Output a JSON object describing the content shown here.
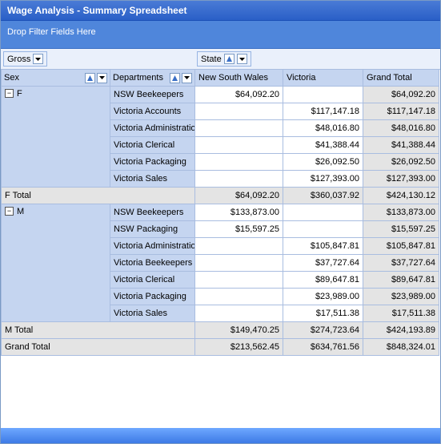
{
  "title": "Wage Analysis - Summary Spreadsheet",
  "filterHint": "Drop Filter Fields Here",
  "dataField": {
    "label": "Gross"
  },
  "colField": {
    "label": "State"
  },
  "rowFields": {
    "sex": "Sex",
    "dept": "Departments"
  },
  "columns": {
    "nsw": "New South Wales",
    "vic": "Victoria",
    "gt": "Grand Total"
  },
  "groups": [
    {
      "key": "F",
      "rows": [
        {
          "dept": "NSW Beekeepers",
          "nsw": "$64,092.20",
          "vic": "",
          "gt": "$64,092.20"
        },
        {
          "dept": "Victoria Accounts",
          "nsw": "",
          "vic": "$117,147.18",
          "gt": "$117,147.18"
        },
        {
          "dept": "Victoria Administration",
          "nsw": "",
          "vic": "$48,016.80",
          "gt": "$48,016.80"
        },
        {
          "dept": "Victoria Clerical",
          "nsw": "",
          "vic": "$41,388.44",
          "gt": "$41,388.44"
        },
        {
          "dept": "Victoria Packaging",
          "nsw": "",
          "vic": "$26,092.50",
          "gt": "$26,092.50"
        },
        {
          "dept": "Victoria Sales",
          "nsw": "",
          "vic": "$127,393.00",
          "gt": "$127,393.00"
        }
      ],
      "totalLabel": "F Total",
      "total": {
        "nsw": "$64,092.20",
        "vic": "$360,037.92",
        "gt": "$424,130.12"
      }
    },
    {
      "key": "M",
      "rows": [
        {
          "dept": "NSW Beekeepers",
          "nsw": "$133,873.00",
          "vic": "",
          "gt": "$133,873.00"
        },
        {
          "dept": "NSW Packaging",
          "nsw": "$15,597.25",
          "vic": "",
          "gt": "$15,597.25"
        },
        {
          "dept": "Victoria Administration",
          "nsw": "",
          "vic": "$105,847.81",
          "gt": "$105,847.81"
        },
        {
          "dept": "Victoria Beekeepers",
          "nsw": "",
          "vic": "$37,727.64",
          "gt": "$37,727.64"
        },
        {
          "dept": "Victoria Clerical",
          "nsw": "",
          "vic": "$89,647.81",
          "gt": "$89,647.81"
        },
        {
          "dept": "Victoria Packaging",
          "nsw": "",
          "vic": "$23,989.00",
          "gt": "$23,989.00"
        },
        {
          "dept": "Victoria Sales",
          "nsw": "",
          "vic": "$17,511.38",
          "gt": "$17,511.38"
        }
      ],
      "totalLabel": "M Total",
      "total": {
        "nsw": "$149,470.25",
        "vic": "$274,723.64",
        "gt": "$424,193.89"
      }
    }
  ],
  "grandTotalLabel": "Grand Total",
  "grandTotal": {
    "nsw": "$213,562.45",
    "vic": "$634,761.56",
    "gt": "$848,324.01"
  },
  "chart_data": {
    "type": "table",
    "title": "Wage Analysis - Summary Spreadsheet",
    "pivot": {
      "data_field": "Gross",
      "column_field": "State",
      "row_fields": [
        "Sex",
        "Departments"
      ],
      "columns": [
        "New South Wales",
        "Victoria",
        "Grand Total"
      ],
      "rows": [
        {
          "Sex": "F",
          "Department": "NSW Beekeepers",
          "New South Wales": 64092.2,
          "Victoria": null,
          "Grand Total": 64092.2
        },
        {
          "Sex": "F",
          "Department": "Victoria Accounts",
          "New South Wales": null,
          "Victoria": 117147.18,
          "Grand Total": 117147.18
        },
        {
          "Sex": "F",
          "Department": "Victoria Administration",
          "New South Wales": null,
          "Victoria": 48016.8,
          "Grand Total": 48016.8
        },
        {
          "Sex": "F",
          "Department": "Victoria Clerical",
          "New South Wales": null,
          "Victoria": 41388.44,
          "Grand Total": 41388.44
        },
        {
          "Sex": "F",
          "Department": "Victoria Packaging",
          "New South Wales": null,
          "Victoria": 26092.5,
          "Grand Total": 26092.5
        },
        {
          "Sex": "F",
          "Department": "Victoria Sales",
          "New South Wales": null,
          "Victoria": 127393.0,
          "Grand Total": 127393.0
        },
        {
          "Sex": "M",
          "Department": "NSW Beekeepers",
          "New South Wales": 133873.0,
          "Victoria": null,
          "Grand Total": 133873.0
        },
        {
          "Sex": "M",
          "Department": "NSW Packaging",
          "New South Wales": 15597.25,
          "Victoria": null,
          "Grand Total": 15597.25
        },
        {
          "Sex": "M",
          "Department": "Victoria Administration",
          "New South Wales": null,
          "Victoria": 105847.81,
          "Grand Total": 105847.81
        },
        {
          "Sex": "M",
          "Department": "Victoria Beekeepers",
          "New South Wales": null,
          "Victoria": 37727.64,
          "Grand Total": 37727.64
        },
        {
          "Sex": "M",
          "Department": "Victoria Clerical",
          "New South Wales": null,
          "Victoria": 89647.81,
          "Grand Total": 89647.81
        },
        {
          "Sex": "M",
          "Department": "Victoria Packaging",
          "New South Wales": null,
          "Victoria": 23989.0,
          "Grand Total": 23989.0
        },
        {
          "Sex": "M",
          "Department": "Victoria Sales",
          "New South Wales": null,
          "Victoria": 17511.38,
          "Grand Total": 17511.38
        }
      ],
      "subtotals": {
        "F": {
          "New South Wales": 64092.2,
          "Victoria": 360037.92,
          "Grand Total": 424130.12
        },
        "M": {
          "New South Wales": 149470.25,
          "Victoria": 274723.64,
          "Grand Total": 424193.89
        }
      },
      "grand_total": {
        "New South Wales": 213562.45,
        "Victoria": 634761.56,
        "Grand Total": 848324.01
      }
    }
  }
}
